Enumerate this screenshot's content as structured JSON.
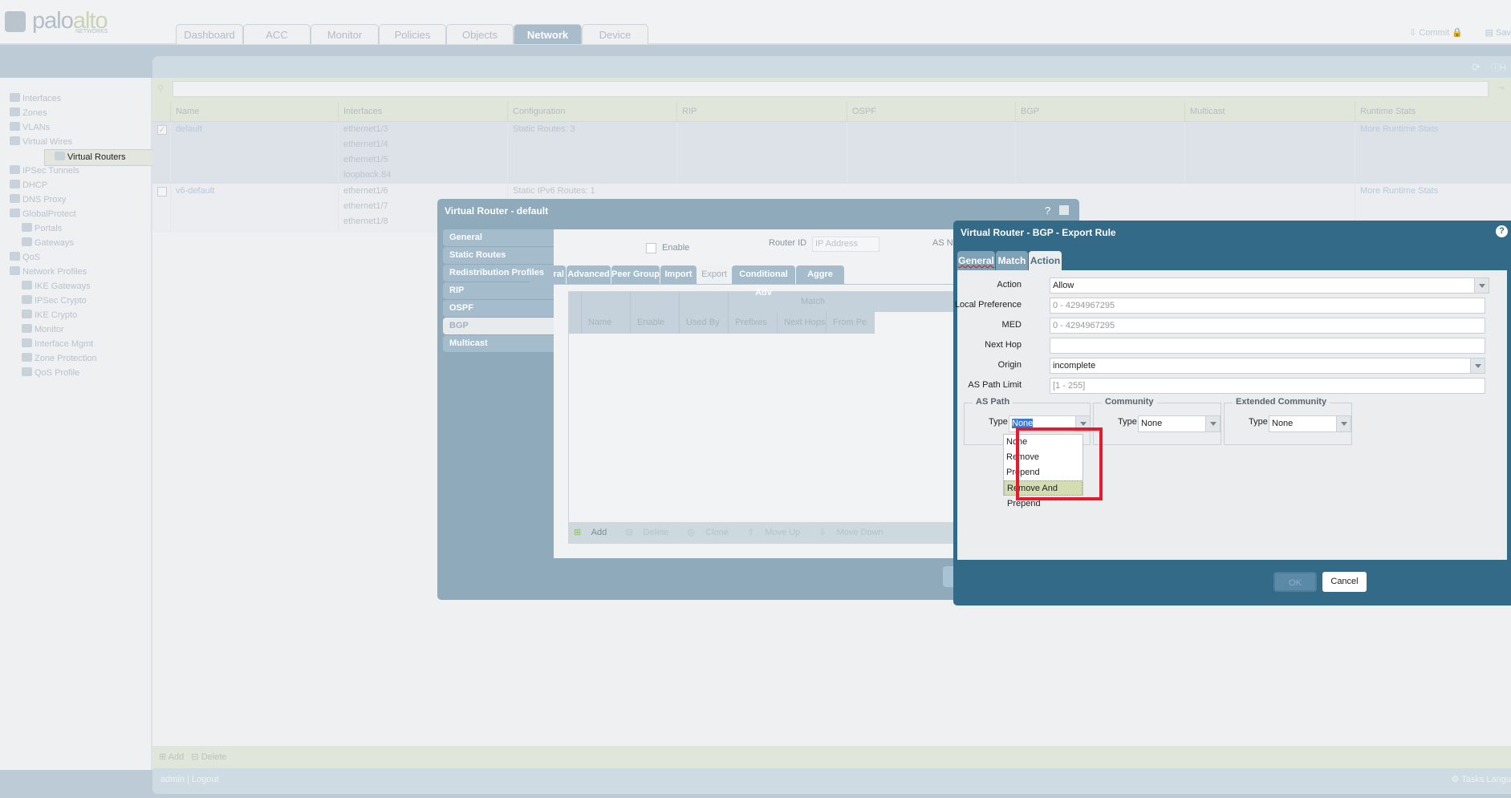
{
  "header": {
    "logo": {
      "palo": "palo",
      "alto": "alto",
      "sub": "NETWORKS"
    },
    "tabs": [
      "Dashboard",
      "ACC",
      "Monitor",
      "Policies",
      "Objects",
      "Network",
      "Device"
    ],
    "active_tab": "Network",
    "commit": "Commit",
    "save": "Sav"
  },
  "sidebar": {
    "items": [
      "Interfaces",
      "Zones",
      "VLANs",
      "Virtual Wires",
      "Virtual Routers",
      "IPSec Tunnels",
      "DHCP",
      "DNS Proxy",
      "GlobalProtect",
      "Portals",
      "Gateways",
      "QoS",
      "Network Profiles",
      "IKE Gateways",
      "IPSec Crypto",
      "IKE Crypto",
      "Monitor",
      "Interface Mgmt",
      "Zone Protection",
      "QoS Profile"
    ],
    "selected": "Virtual Routers"
  },
  "main": {
    "help": "H",
    "columns": [
      "Name",
      "Interfaces",
      "Configuration",
      "RIP",
      "OSPF",
      "BGP",
      "Multicast",
      "Runtime Stats"
    ],
    "rows": [
      {
        "name": "default",
        "checked": true,
        "interfaces": [
          "ethernet1/3",
          "ethernet1/4",
          "ethernet1/5",
          "loopback.84"
        ],
        "configuration": "Static Routes: 3",
        "runtime": "More Runtime Stats"
      },
      {
        "name": "v6-default",
        "checked": false,
        "interfaces": [
          "ethernet1/6",
          "ethernet1/7",
          "ethernet1/8"
        ],
        "configuration": "Static IPv6 Routes: 1",
        "runtime": "More Runtime Stats"
      }
    ],
    "add": "Add",
    "delete": "Delete"
  },
  "footer": {
    "user": "admin",
    "logout": "Logout",
    "tasks": "Tasks",
    "language": "Langu"
  },
  "dialog1": {
    "title": "Virtual Router - default",
    "nav": [
      "General",
      "Static Routes",
      "Redistribution Profiles",
      "RIP",
      "OSPF",
      "BGP",
      "Multicast"
    ],
    "active_nav": "BGP",
    "enable": "Enable",
    "router_id": "Router ID",
    "router_id_placeholder": "IP Address",
    "as_number": "AS Nu",
    "tabs": [
      "General",
      "Advanced",
      "Peer Group",
      "Import",
      "Export",
      "Conditional Adv",
      "Aggre"
    ],
    "active_tab": "Export",
    "table": {
      "group": "Match",
      "columns": [
        "Name",
        "Enable",
        "Used By",
        "Prefixes",
        "Next Hops",
        "From Pe"
      ]
    },
    "toolbar": [
      "Add",
      "Delete",
      "Clone",
      "Move Up",
      "Move Down"
    ]
  },
  "dialog2": {
    "title": "Virtual Router - BGP - Export Rule",
    "tabs": [
      "General",
      "Match",
      "Action"
    ],
    "active_tab": "Action",
    "fields": {
      "action": {
        "label": "Action",
        "value": "Allow"
      },
      "local_pref": {
        "label": "Local Preference",
        "placeholder": "0 - 4294967295"
      },
      "med": {
        "label": "MED",
        "placeholder": "0 - 4294967295"
      },
      "next_hop": {
        "label": "Next Hop",
        "value": ""
      },
      "origin": {
        "label": "Origin",
        "value": "incomplete"
      },
      "as_path_limit": {
        "label": "AS Path Limit",
        "placeholder": "[1 - 255]"
      }
    },
    "as_path": {
      "legend": "AS Path",
      "type_label": "Type",
      "value": "None",
      "options": [
        "None",
        "Remove",
        "Prepend",
        "Remove And Prepend"
      ],
      "highlighted": "Remove And Prepend"
    },
    "community": {
      "legend": "Community",
      "type_label": "Type",
      "value": "None"
    },
    "extended_community": {
      "legend": "Extended Community",
      "type_label": "Type",
      "value": "None"
    },
    "ok": "OK",
    "cancel": "Cancel"
  },
  "colors": {
    "dialog_dark": "#336a87",
    "dialog_light": "#8eaabb",
    "highlight_box": "#e8192c",
    "option_highlight": "#d3dcb3"
  }
}
